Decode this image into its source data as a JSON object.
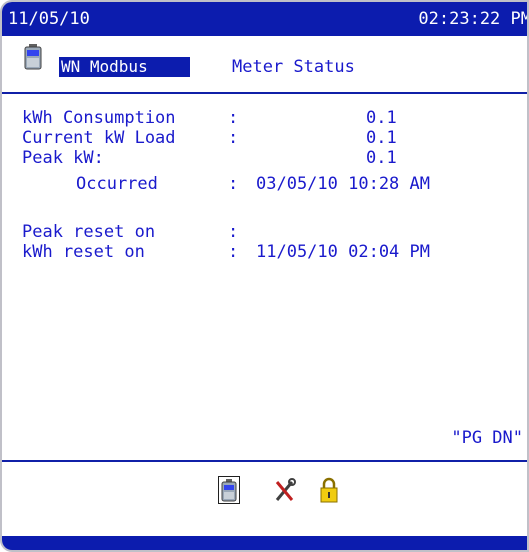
{
  "header": {
    "date": "11/05/10",
    "time": "02:23:22 PM"
  },
  "title": {
    "selected_label": "WN Modbus",
    "screen_label": "Meter Status"
  },
  "rows": [
    {
      "label": "kWh Consumption",
      "sep": ":",
      "value": "0.1"
    },
    {
      "label": "Current kW Load",
      "sep": ":",
      "value": "0.1"
    },
    {
      "label": "Peak kW:",
      "sep": "",
      "value": "0.1"
    },
    {
      "label": "Occurred",
      "sep": ":",
      "value": "03/05/10 10:28 AM"
    },
    {
      "label": "Peak reset on",
      "sep": ":",
      "value": ""
    },
    {
      "label": "kWh reset on",
      "sep": ":",
      "value": "11/05/10 02:04 PM"
    }
  ],
  "footer_hint": "\"PG DN\"",
  "icons": [
    "battery-meter-icon",
    "tools-icon",
    "lock-icon"
  ],
  "colors": {
    "bar": "#0c1cae",
    "text": "#1a1acc",
    "background": "#ffffff"
  }
}
